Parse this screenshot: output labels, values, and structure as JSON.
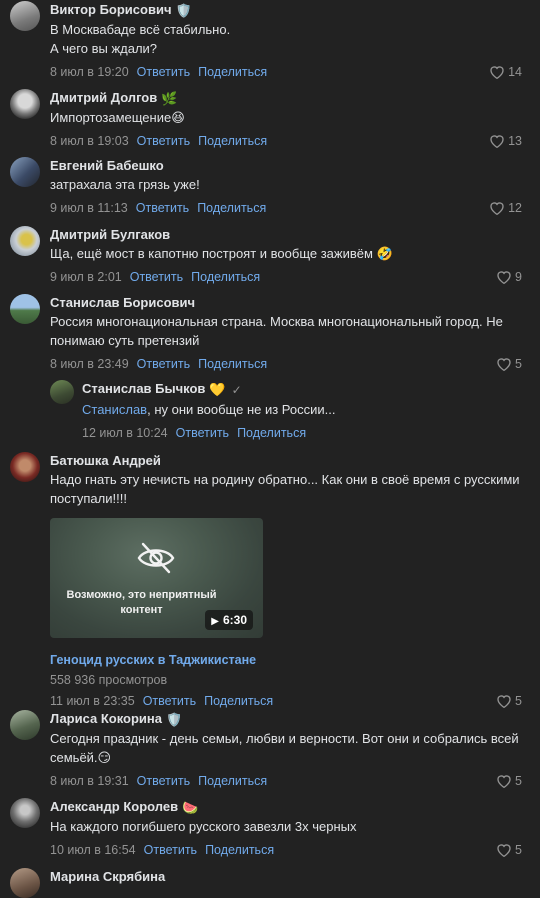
{
  "actions": {
    "reply": "Ответить",
    "share": "Поделиться"
  },
  "comments": [
    {
      "author": "Виктор Борисович",
      "badge": "🛡️",
      "lines": [
        "В Москвабаде всё стабильно.",
        "А чего вы ждали?"
      ],
      "time": "8 июл в 19:20",
      "likes": "14"
    },
    {
      "author": "Дмитрий Долгов",
      "badge": "🌿",
      "text": "Импортозамещение😆",
      "time": "8 июл в 19:03",
      "likes": "13"
    },
    {
      "author": "Евгений Бабешко",
      "text": "затрахала эта грязь уже!",
      "time": "9 июл в 11:13",
      "likes": "12"
    },
    {
      "author": "Дмитрий Булгаков",
      "text": "Ща, ещё мост в капотню построят и вообще заживём 🤣",
      "time": "9 июл в 2:01",
      "likes": "9"
    },
    {
      "author": "Станислав Борисович",
      "text": "Россия многонациональная страна. Москва многонациональный город. Не понимаю суть претензий",
      "time": "8 июл в 23:49",
      "likes": "5"
    },
    {
      "author": "Станислав Бычков",
      "badge": "💛",
      "check": "✓",
      "mention": "Станислав",
      "text": ", ну они вообще не из России...",
      "time": "12 июл в 10:24"
    },
    {
      "author": "Батюшка Андрей",
      "text": "Надо гнать эту нечисть на родину обратно... Как они в своё время с русскими поступали!!!!",
      "video": {
        "warning": "Возможно, это неприятный контент",
        "duration": "6:30",
        "title": "Геноцид русских в Таджикистане",
        "views": "558 936 просмотров"
      },
      "time": "11 июл в 23:35",
      "likes": "5"
    },
    {
      "author": "Лариса Кокорина",
      "badge": "🛡️",
      "text": "Сегодня праздник - день семьи, любви и верности. Вот они и собрались всей семьёй.😏",
      "time": "8 июл в 19:31",
      "likes": "5"
    },
    {
      "author": "Александр Королев",
      "badge": "🍉",
      "text": "На каждого погибшего русского завезли 3х черных",
      "time": "10 июл в 16:54",
      "likes": "5"
    },
    {
      "author": "Марина Скрябина"
    }
  ],
  "colors": {
    "background": "#222222",
    "text": "#e1e3e6",
    "link": "#71aaeb",
    "secondary": "#939393"
  }
}
